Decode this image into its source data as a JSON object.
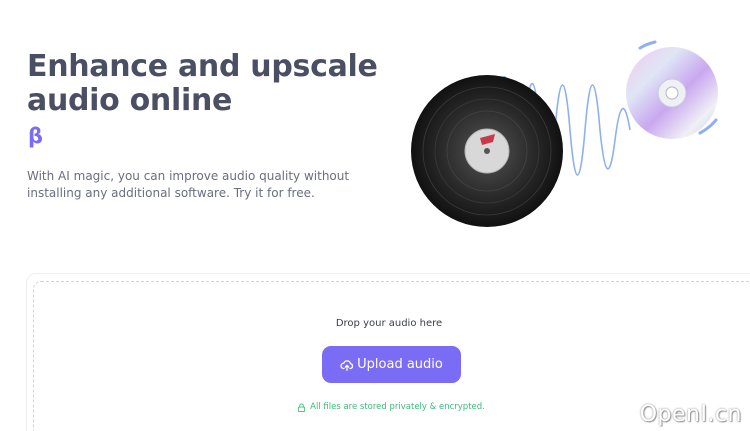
{
  "hero": {
    "title": "Enhance and upscale audio online",
    "beta": "β",
    "description": "With AI magic, you can improve audio quality without installing any additional software. Try it for free."
  },
  "upload": {
    "drop_text": "Drop your audio here",
    "button_label": "Upload audio",
    "button_icon": "upload-cloud-icon",
    "privacy_text": "All files are stored privately & encrypted.",
    "privacy_icon": "lock-icon"
  },
  "watermark": "OpenI.cn",
  "colors": {
    "accent": "#7b6cf6",
    "title": "#4b4f63",
    "privacy_green": "#3dbb7a",
    "wave": "#8fb0f0"
  }
}
